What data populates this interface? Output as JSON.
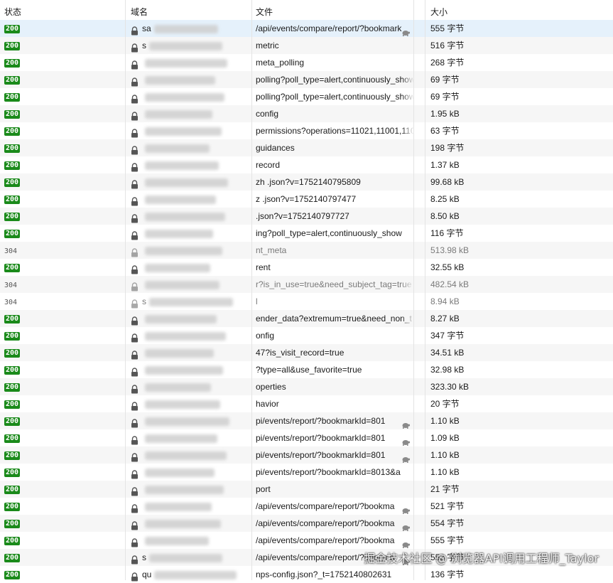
{
  "header": {
    "status": "状态",
    "domain": "域名",
    "file": "文件",
    "size": "大小"
  },
  "rows": [
    {
      "status": "200",
      "domain": "sa",
      "file": "/api/events/compare/report/?bookmark",
      "size": "555 字节",
      "turtle": true,
      "selected": true
    },
    {
      "status": "200",
      "domain": "s",
      "file": "metric",
      "size": "516 字节"
    },
    {
      "status": "200",
      "domain": "",
      "file": "meta_polling",
      "size": "268 字节"
    },
    {
      "status": "200",
      "domain": "",
      "file": "polling?poll_type=alert,continuously_show",
      "size": "69 字节"
    },
    {
      "status": "200",
      "domain": "",
      "file": "polling?poll_type=alert,continuously_show",
      "size": "69 字节"
    },
    {
      "status": "200",
      "domain": "",
      "file": "config",
      "size": "1.95 kB"
    },
    {
      "status": "200",
      "domain": "",
      "file": "permissions?operations=11021,11001,110",
      "size": "63 字节"
    },
    {
      "status": "200",
      "domain": "",
      "file": "guidances",
      "size": "198 字节"
    },
    {
      "status": "200",
      "domain": "",
      "file": "record",
      "size": "1.37 kB"
    },
    {
      "status": "200",
      "domain": "",
      "file": "zh .json?v=1752140795809",
      "size": "99.68 kB"
    },
    {
      "status": "200",
      "domain": "",
      "file": "z .json?v=1752140797477",
      "size": "8.25 kB"
    },
    {
      "status": "200",
      "domain": "",
      "file": ".json?v=1752140797727",
      "size": "8.50 kB"
    },
    {
      "status": "200",
      "domain": "",
      "file": "ing?poll_type=alert,continuously_show",
      "size": "116 字节"
    },
    {
      "status": "304",
      "domain": "",
      "file": "nt_meta",
      "size": "513.98 kB",
      "muted": true
    },
    {
      "status": "200",
      "domain": "",
      "file": "rent",
      "size": "32.55 kB"
    },
    {
      "status": "304",
      "domain": "",
      "file": "r?is_in_use=true&need_subject_tag=true",
      "size": "482.54 kB",
      "muted": true
    },
    {
      "status": "304",
      "domain": "s",
      "file": "l",
      "size": "8.94 kB",
      "muted": true
    },
    {
      "status": "200",
      "domain": "",
      "file": "ender_data?extremum=true&need_non_t",
      "size": "8.27 kB"
    },
    {
      "status": "200",
      "domain": "",
      "file": "onfig",
      "size": "347 字节"
    },
    {
      "status": "200",
      "domain": "",
      "file": "47?is_visit_record=true",
      "size": "34.51 kB"
    },
    {
      "status": "200",
      "domain": "",
      "file": "?type=all&use_favorite=true",
      "size": "32.98 kB"
    },
    {
      "status": "200",
      "domain": "",
      "file": "operties",
      "size": "323.30 kB"
    },
    {
      "status": "200",
      "domain": "",
      "file": "havior",
      "size": "20 字节"
    },
    {
      "status": "200",
      "domain": "",
      "file": "pi/events/report/?bookmarkId=801",
      "size": "1.10 kB",
      "turtle": true
    },
    {
      "status": "200",
      "domain": "",
      "file": "pi/events/report/?bookmarkId=801",
      "size": "1.09 kB",
      "turtle": true
    },
    {
      "status": "200",
      "domain": "",
      "file": "pi/events/report/?bookmarkId=801",
      "size": "1.10 kB",
      "turtle": true
    },
    {
      "status": "200",
      "domain": "",
      "file": "pi/events/report/?bookmarkId=8013&a",
      "size": "1.10 kB"
    },
    {
      "status": "200",
      "domain": "",
      "file": "port",
      "size": "21 字节"
    },
    {
      "status": "200",
      "domain": "",
      "file": "/api/events/compare/report/?bookma",
      "size": "521 字节",
      "turtle": true
    },
    {
      "status": "200",
      "domain": "",
      "file": "/api/events/compare/report/?bookma",
      "size": "554 字节",
      "turtle": true
    },
    {
      "status": "200",
      "domain": "",
      "file": "/api/events/compare/report/?bookma",
      "size": "555 字节",
      "turtle": true
    },
    {
      "status": "200",
      "domain": "s",
      "file": "/api/events/compare/report/?bookma",
      "size": "553 字节",
      "turtle": true
    },
    {
      "status": "200",
      "domain": "qu",
      "file": "nps-config.json?_t=1752140802631",
      "size": "136 字节"
    }
  ],
  "watermark": "掘金技术社区 @ 浏览器API调用工程师_Taylor",
  "colors": {
    "badge": "#1a8a1a",
    "selected_row": "#e5f1fb",
    "alt_row": "#f6f6f6"
  }
}
